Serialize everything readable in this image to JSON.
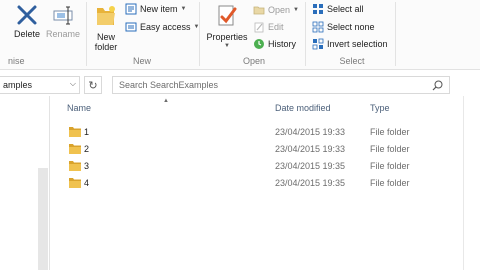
{
  "ribbon": {
    "organize": {
      "delete_label": "Delete",
      "rename_label": "Rename",
      "group_label_partial": "nise"
    },
    "new": {
      "new_folder_line1": "New",
      "new_folder_line2": "folder",
      "new_item_label": "New item",
      "easy_access_label": "Easy access",
      "group_label": "New"
    },
    "open": {
      "properties_label": "Properties",
      "open_label": "Open",
      "edit_label": "Edit",
      "history_label": "History",
      "group_label": "Open"
    },
    "select": {
      "select_all_label": "Select all",
      "select_none_label": "Select none",
      "invert_selection_label": "Invert selection",
      "group_label": "Select"
    }
  },
  "address_bar": {
    "path_partial": "amples"
  },
  "search": {
    "placeholder": "Search SearchExamples"
  },
  "file_list": {
    "columns": {
      "name": "Name",
      "date_modified": "Date modified",
      "type": "Type"
    },
    "rows": [
      {
        "name": "1",
        "date": "23/04/2015 19:33",
        "type": "File folder"
      },
      {
        "name": "2",
        "date": "23/04/2015 19:33",
        "type": "File folder"
      },
      {
        "name": "3",
        "date": "23/04/2015 19:35",
        "type": "File folder"
      },
      {
        "name": "4",
        "date": "23/04/2015 19:35",
        "type": "File folder"
      }
    ]
  },
  "colors": {
    "folder_yellow": "#e8b33a",
    "header_text": "#4c607a",
    "accent_blue": "#2a6ebb"
  }
}
